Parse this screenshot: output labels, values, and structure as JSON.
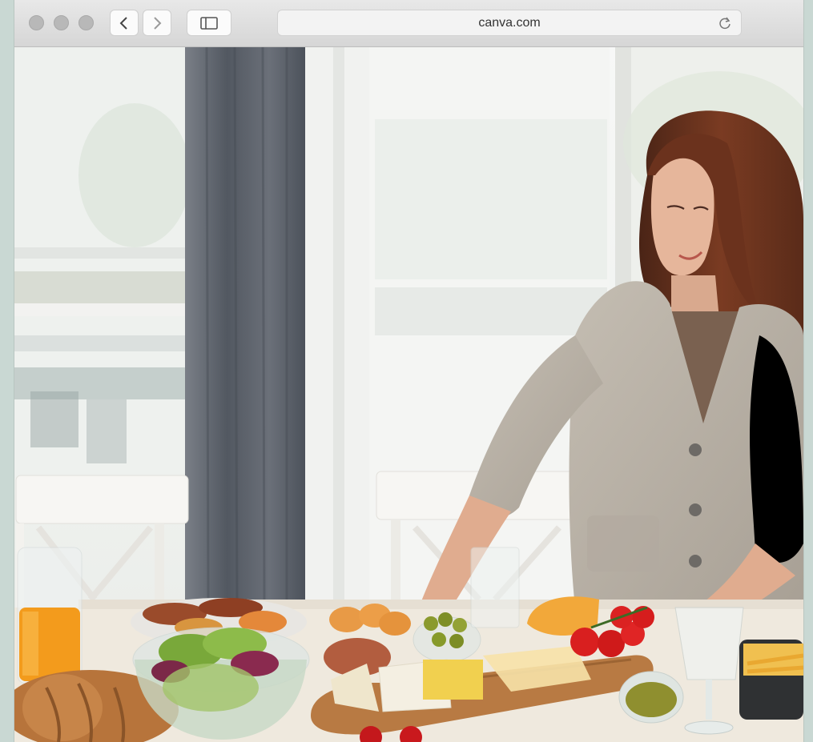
{
  "browser": {
    "url": "canva.com",
    "traffic_lights": [
      "close",
      "minimize",
      "zoom"
    ],
    "icons": {
      "back": "chevron-left-icon",
      "forward": "chevron-right-icon",
      "sidebar": "sidebar-icon",
      "reload": "reload-icon"
    }
  },
  "photo": {
    "subject": "woman-setting-table",
    "colors": {
      "window_light": "#f2f4f3",
      "curtain": "#5f656e",
      "cardigan": "#b9b1a6",
      "hair": "#6a3220",
      "table": "#efe8dc",
      "orange_juice": "#f39b1c",
      "tomato": "#d91f1f"
    }
  }
}
